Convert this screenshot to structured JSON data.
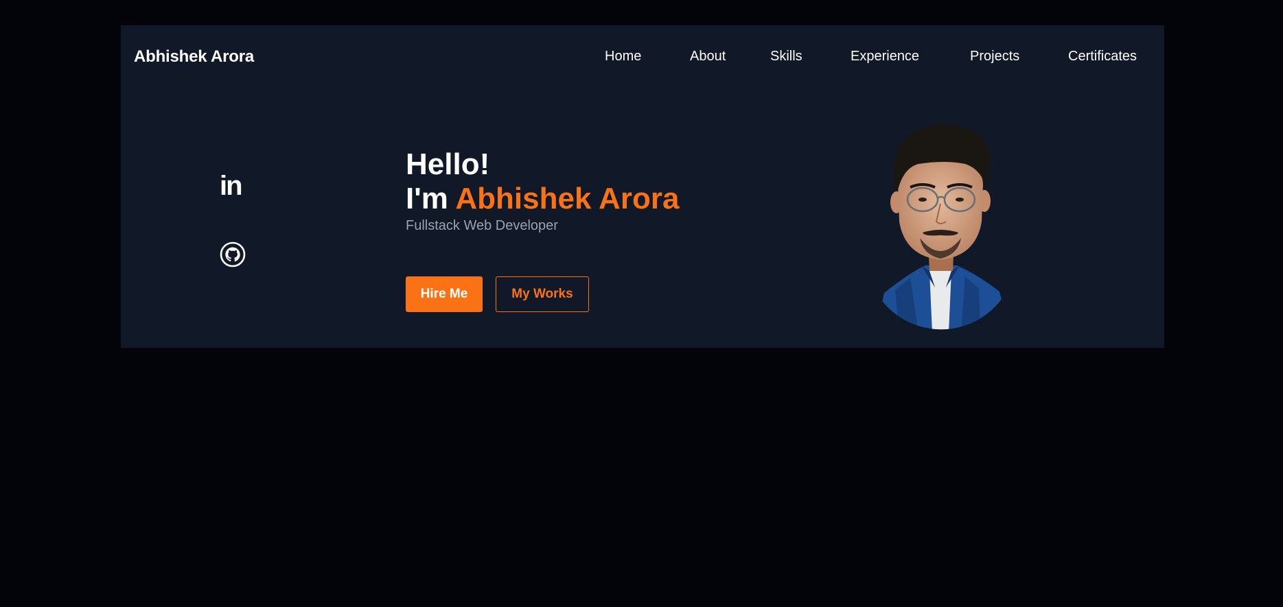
{
  "header": {
    "brand": "Abhishek Arora",
    "nav": [
      "Home",
      "About",
      "Skills",
      "Experience",
      "Projects",
      "Certificates"
    ]
  },
  "social": {
    "linkedin_label": "in",
    "icons": [
      "linkedin-icon",
      "github-icon"
    ]
  },
  "hero": {
    "greeting": "Hello!",
    "intro_prefix": "I'm ",
    "name": "Abhishek Arora",
    "role": "Fullstack Web Developer",
    "hire_label": "Hire Me",
    "works_label": "My Works"
  },
  "colors": {
    "accent": "#f97316",
    "panel": "#111827",
    "page": "#03040a",
    "muted": "#9ca3af"
  }
}
